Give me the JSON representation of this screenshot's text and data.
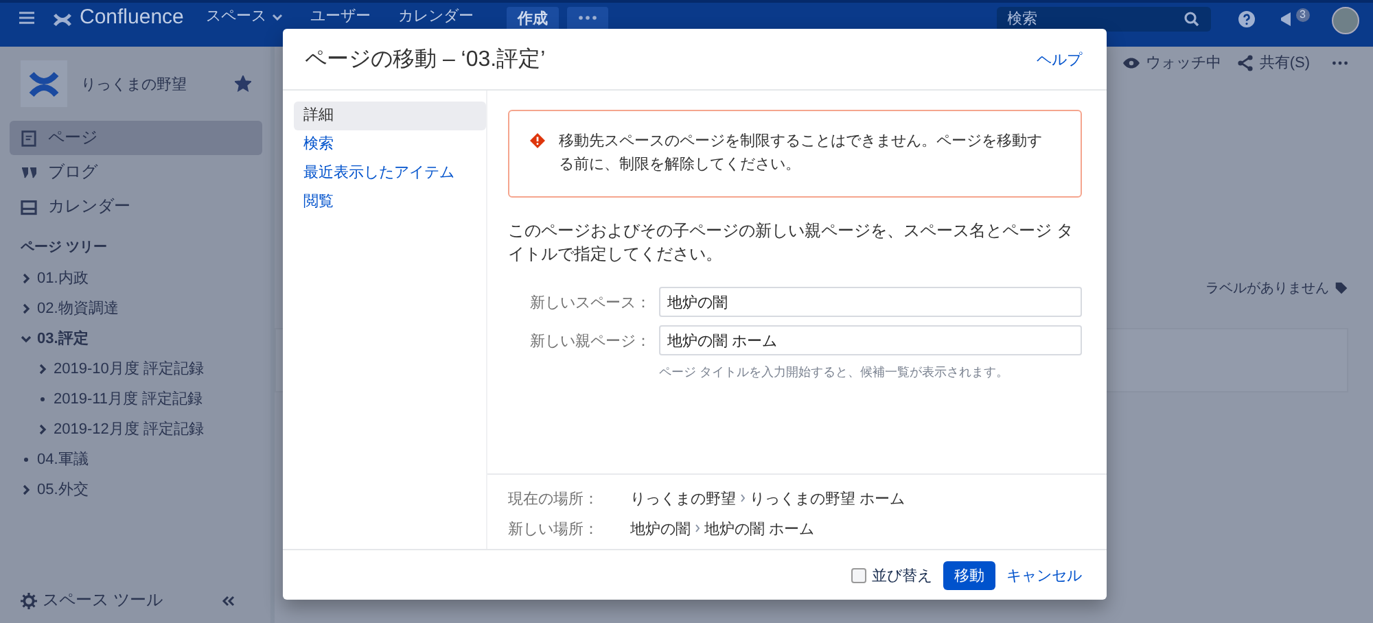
{
  "header": {
    "logo": "Confluence",
    "nav": [
      {
        "label": "スペース",
        "dropdown": true
      },
      {
        "label": "ユーザー",
        "dropdown": false
      },
      {
        "label": "カレンダー",
        "dropdown": false
      }
    ],
    "create": "作成",
    "search": {
      "placeholder": "検索"
    },
    "notifications": "3"
  },
  "sidebar": {
    "space_name": "りっくまの野望",
    "starred": true,
    "nav": [
      {
        "label": "ページ",
        "kind": "page",
        "selected": true
      },
      {
        "label": "ブログ",
        "kind": "blog",
        "selected": false
      },
      {
        "label": "カレンダー",
        "kind": "calendar",
        "selected": false
      }
    ],
    "tree_title": "ページ ツリー",
    "tree": [
      {
        "label": "01.内政",
        "kind": "branch",
        "expanded": false,
        "selected": false
      },
      {
        "label": "02.物資調達",
        "kind": "branch",
        "expanded": false,
        "selected": false
      },
      {
        "label": "03.評定",
        "kind": "branch",
        "expanded": true,
        "selected": true,
        "children": [
          {
            "label": "2019-10月度 評定記録",
            "kind": "branch",
            "expanded": false,
            "selected": false
          },
          {
            "label": "2019-11月度 評定記録",
            "kind": "leaf",
            "selected": false
          },
          {
            "label": "2019-12月度 評定記録",
            "kind": "branch",
            "expanded": false,
            "selected": false
          }
        ]
      },
      {
        "label": "04.軍議",
        "kind": "leaf",
        "selected": false
      },
      {
        "label": "05.外交",
        "kind": "branch",
        "expanded": false,
        "selected": false
      }
    ],
    "tools": "スペース ツール"
  },
  "page_actions": [
    {
      "label": "ウォッチ中",
      "kind": "watch"
    },
    {
      "label": "共有(S)",
      "kind": "share"
    }
  ],
  "labels": "ラベルがありません",
  "dialog": {
    "title": "ページの移動 – ‘03.評定’",
    "help": "ヘルプ",
    "nav": [
      {
        "label": "詳細",
        "selected": true
      },
      {
        "label": "検索",
        "selected": false
      },
      {
        "label": "最近表示したアイテム",
        "selected": false
      },
      {
        "label": "閲覧",
        "selected": false
      }
    ],
    "error": "移動先スペースのページを制限することはできません。ページを移動する前に、制限を解除してください。",
    "instructions": "このページおよびその子ページの新しい親ページを、スペース名とページ タイトルで指定してください。",
    "fields": [
      {
        "label": "新しいスペース：",
        "value": "地炉の闇"
      },
      {
        "label": "新しい親ページ：",
        "value": "地炉の闇 ホーム"
      }
    ],
    "hint": "ページ タイトルを入力開始すると、候補一覧が表示されます。",
    "locations": [
      {
        "label": "現在の場所：",
        "path": [
          "りっくまの野望",
          "りっくまの野望 ホーム"
        ]
      },
      {
        "label": "新しい場所：",
        "path": [
          "地炉の闇",
          "地炉の闇 ホーム"
        ]
      }
    ],
    "reorder": {
      "label": "並び替え",
      "checked": false
    },
    "submit": "移動",
    "cancel": "キャンセル"
  }
}
